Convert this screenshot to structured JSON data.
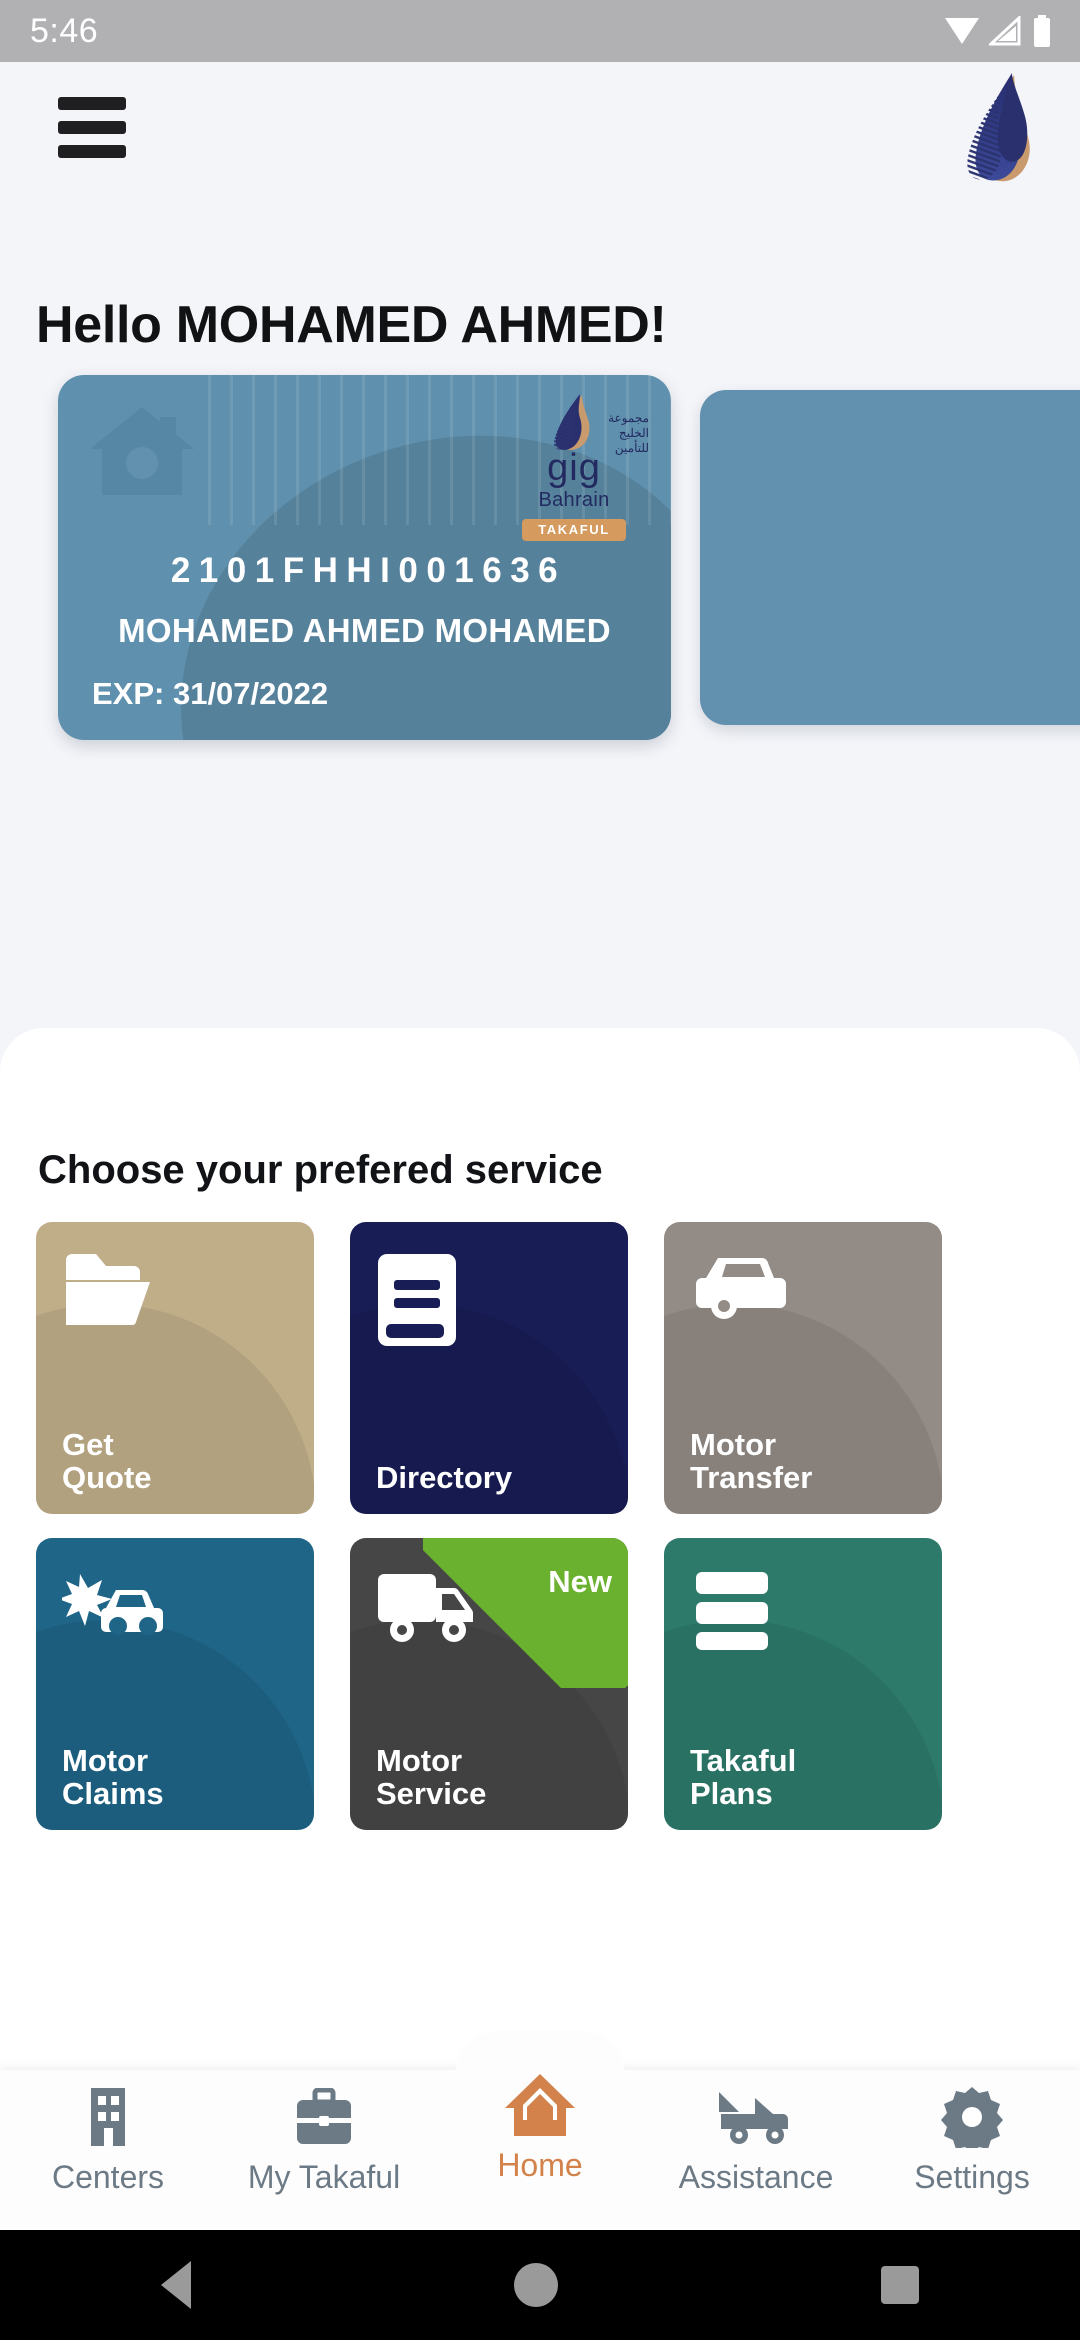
{
  "status_bar": {
    "time": "5:46",
    "icons": [
      "wifi-icon",
      "cellular-signal-icon",
      "battery-icon"
    ]
  },
  "header": {
    "menu_icon": "hamburger-menu-icon",
    "logo_name": "gig-bahrain-logo"
  },
  "greeting": {
    "text": "Hello MOHAMED AHMED!"
  },
  "policy_card": {
    "number": "2101FHHI001636",
    "holder_name": "MOHAMED AHMED MOHAMED",
    "expiry_label": "EXP: 31/07/2022",
    "brand": {
      "gig": "gig",
      "region": "Bahrain",
      "product_badge": "TAKAFUL",
      "arabic_line1": "مجموعة",
      "arabic_line2": "الخليج",
      "arabic_line3": "للتأمين"
    },
    "watermark_icon": "home-insurance-icon",
    "background_color": "#5f90ad"
  },
  "services": {
    "title": "Choose your prefered service",
    "tiles": [
      {
        "label": "Get\nQuote",
        "label_line1": "Get",
        "label_line2": "Quote",
        "color": "#bfae88",
        "icon": "folder-icon"
      },
      {
        "label": "Directory",
        "label_line1": "Directory",
        "label_line2": "",
        "color": "#181d56",
        "icon": "book-icon"
      },
      {
        "label": "Motor\nTransfer",
        "label_line1": "Motor",
        "label_line2": "Transfer",
        "color": "#938b85",
        "icon": "vehicle-front-icon"
      },
      {
        "label": "Motor\nClaims",
        "label_line1": "Motor",
        "label_line2": "Claims",
        "color": "#1f6588",
        "icon": "car-crash-icon"
      },
      {
        "label": "Motor\nService",
        "label_line1": "Motor",
        "label_line2": "Service",
        "color": "#464646",
        "icon": "truck-icon",
        "badge": "New",
        "badge_color": "#6ab12f"
      },
      {
        "label": "Takaful\nPlans",
        "label_line1": "Takaful",
        "label_line2": "Plans",
        "color": "#2d7a6b",
        "icon": "card-stack-icon"
      }
    ]
  },
  "bottom_nav": {
    "active": "Home",
    "active_color": "#d2824a",
    "inactive_color": "#6c7a86",
    "items": [
      {
        "label": "Centers",
        "icon": "building-icon"
      },
      {
        "label": "My Takaful",
        "icon": "briefcase-icon"
      },
      {
        "label": "Home",
        "icon": "home-icon"
      },
      {
        "label": "Assistance",
        "icon": "tow-truck-icon"
      },
      {
        "label": "Settings",
        "icon": "gear-icon"
      }
    ]
  },
  "android_nav": {
    "buttons": [
      "back-button",
      "home-button",
      "recents-button"
    ]
  }
}
